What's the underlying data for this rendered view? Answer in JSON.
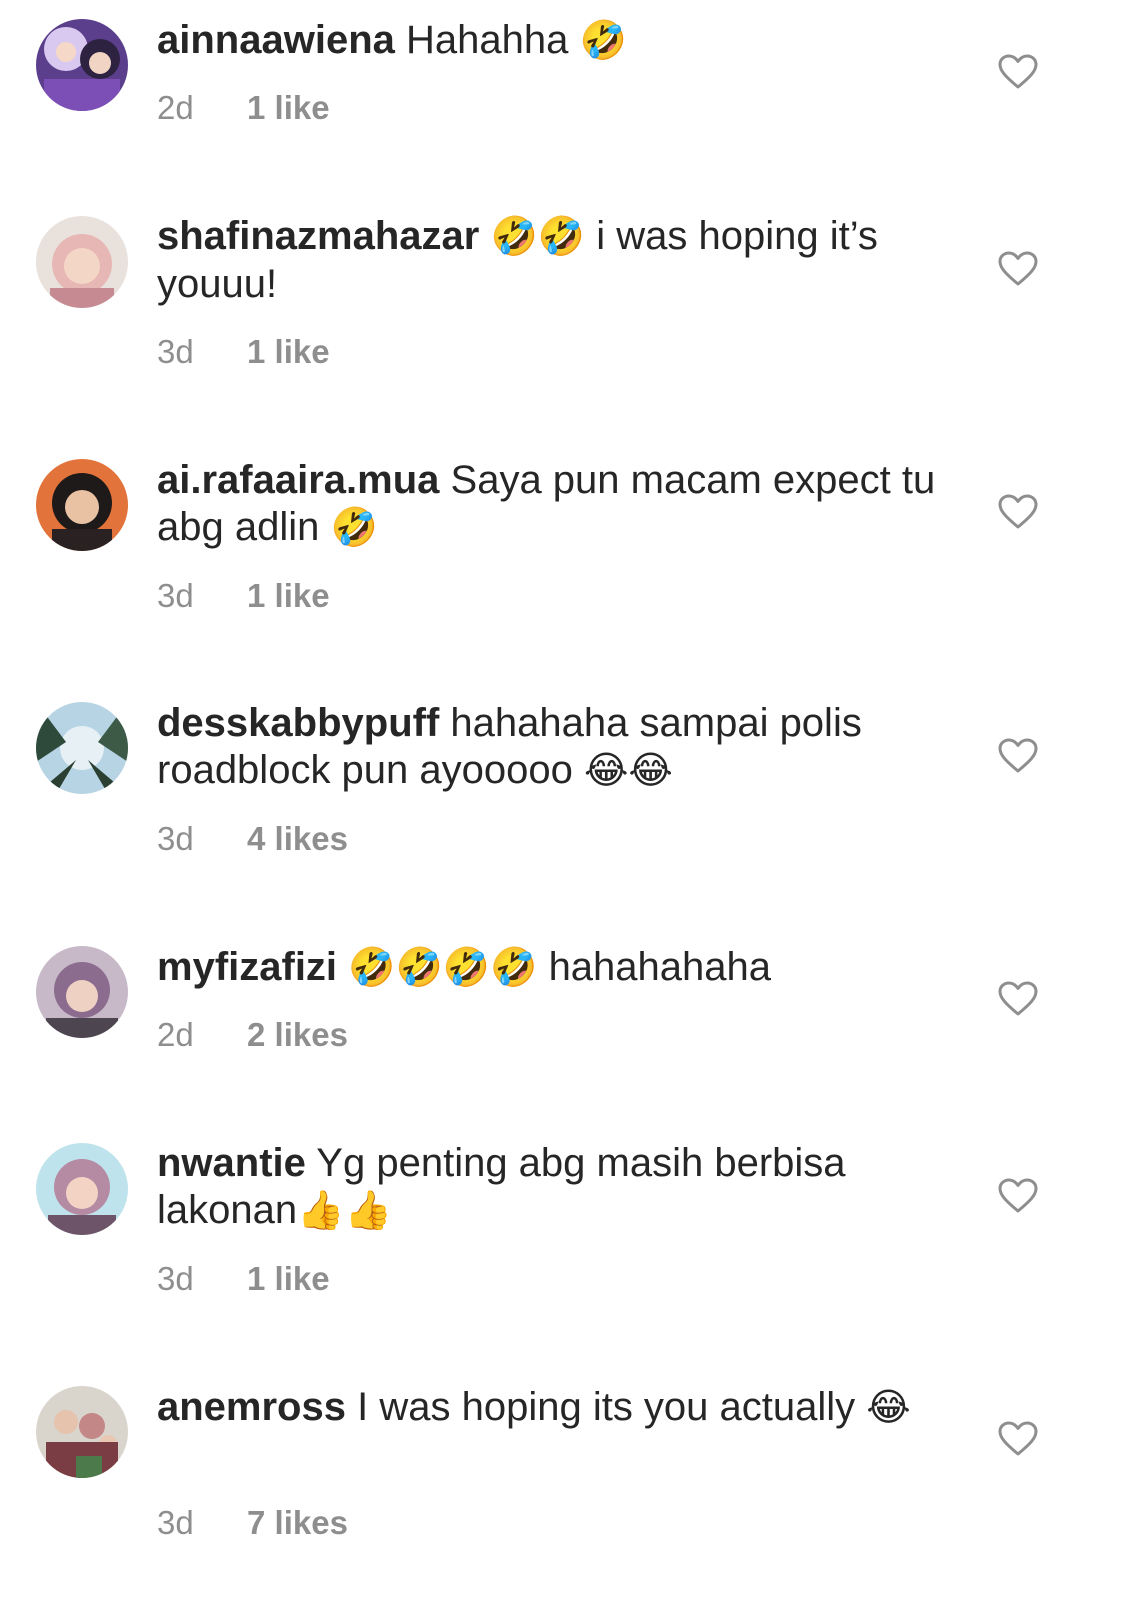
{
  "comments": [
    {
      "username": "ainnaawiena",
      "text": "Hahahha",
      "emoji_after": "🤣",
      "time": "2d",
      "likes": "1 like"
    },
    {
      "username": "shafinazmahazar",
      "emoji_before": "🤣🤣",
      "text": "i was hoping it’s youuu!",
      "time": "3d",
      "likes": "1 like"
    },
    {
      "username": "ai.rafaaira.mua",
      "text": "Saya pun macam expect tu abg adlin",
      "emoji_after": "🤣",
      "time": "3d",
      "likes": "1 like"
    },
    {
      "username": "desskabbypuff",
      "text": "hahahaha sampai polis roadblock pun ayooooo",
      "emoji_after": "😂😂",
      "time": "3d",
      "likes": "4 likes"
    },
    {
      "username": "myfizafizi",
      "emoji_before": "🤣🤣🤣🤣",
      "text": "hahahahaha",
      "time": "2d",
      "likes": "2 likes"
    },
    {
      "username": "nwantie",
      "text": "Yg penting abg masih berbisa lakonan",
      "emoji_after": "👍👍",
      "time": "3d",
      "likes": "1 like"
    },
    {
      "username": "anemross",
      "text": "I was hoping its you actually",
      "emoji_after": "😂",
      "time": "3d",
      "likes": "7 likes"
    }
  ],
  "icons": {
    "like": "heart-outline-icon"
  },
  "colors": {
    "text": "#262626",
    "meta": "#8e8e8e"
  }
}
